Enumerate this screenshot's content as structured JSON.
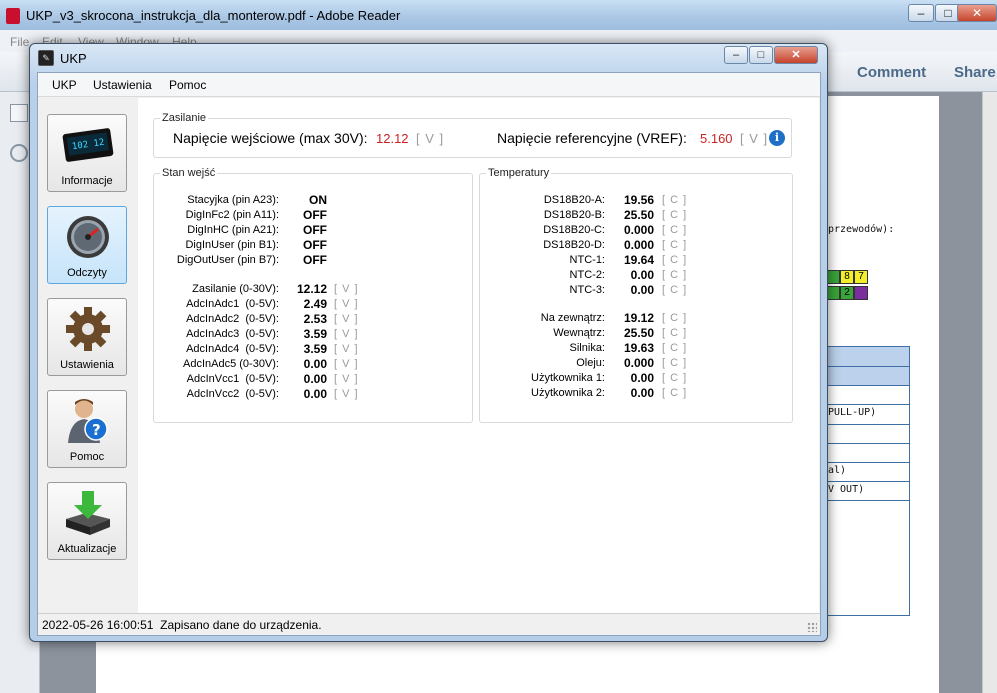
{
  "background": {
    "title": "UKP_v3_skrocona_instrukcja_dla_monterow.pdf - Adobe Reader",
    "menu": [
      "File",
      "Edit",
      "View",
      "Window",
      "Help"
    ],
    "toolbar": {
      "comment": "Comment",
      "share": "Share"
    },
    "doc_fragments": {
      "wires": "przewodów):",
      "pullup": "PULL-UP)",
      "al": "al)",
      "vout": "V OUT)",
      "pin8": "8",
      "pin7": "7",
      "pin2": "2"
    }
  },
  "window": {
    "title": "UKP",
    "menu": {
      "ukp": "UKP",
      "settings": "Ustawienia",
      "help": "Pomoc"
    }
  },
  "nav": [
    {
      "label": "Informacje",
      "icon": "display-icon"
    },
    {
      "label": "Odczyty",
      "icon": "gauge-icon",
      "active": true
    },
    {
      "label": "Ustawienia",
      "icon": "gear-icon"
    },
    {
      "label": "Pomoc",
      "icon": "help-person-icon"
    },
    {
      "label": "Aktualizacje",
      "icon": "download-icon"
    }
  ],
  "supply": {
    "title": "Zasilanie",
    "input_label": "Napięcie wejściowe (max 30V):",
    "input_value": "12.12",
    "input_unit": "[ V ]",
    "ref_label": "Napięcie referencyjne (VREF):",
    "ref_value": "5.160",
    "ref_unit": "[ V ]",
    "value_color": "#cc2222"
  },
  "inputs": {
    "title": "Stan wejść",
    "digital": [
      {
        "label": "Stacyjka (pin A23):",
        "value": "ON"
      },
      {
        "label": "DigInFc2 (pin A11):",
        "value": "OFF"
      },
      {
        "label": "DigInHC (pin A21):",
        "value": "OFF"
      },
      {
        "label": "DigInUser (pin B1):",
        "value": "OFF"
      },
      {
        "label": "DigOutUser (pin B7):",
        "value": "OFF"
      }
    ],
    "analog": [
      {
        "label": "Zasilanie (0-30V):",
        "value": "12.12",
        "unit": "[ V ]"
      },
      {
        "label": "AdcInAdc1  (0-5V):",
        "value": "2.49",
        "unit": "[ V ]"
      },
      {
        "label": "AdcInAdc2  (0-5V):",
        "value": "2.53",
        "unit": "[ V ]"
      },
      {
        "label": "AdcInAdc3  (0-5V):",
        "value": "3.59",
        "unit": "[ V ]"
      },
      {
        "label": "AdcInAdc4  (0-5V):",
        "value": "3.59",
        "unit": "[ V ]"
      },
      {
        "label": "AdcInAdc5 (0-30V):",
        "value": "0.00",
        "unit": "[ V ]"
      },
      {
        "label": "AdcInVcc1  (0-5V):",
        "value": "0.00",
        "unit": "[ V ]"
      },
      {
        "label": "AdcInVcc2  (0-5V):",
        "value": "0.00",
        "unit": "[ V ]"
      }
    ]
  },
  "temperatures": {
    "title": "Temperatury",
    "sensors": [
      {
        "label": "DS18B20-A:",
        "value": "19.56",
        "unit": "[ C ]"
      },
      {
        "label": "DS18B20-B:",
        "value": "25.50",
        "unit": "[ C ]"
      },
      {
        "label": "DS18B20-C:",
        "value": "0.000",
        "unit": "[ C ]"
      },
      {
        "label": "DS18B20-D:",
        "value": "0.000",
        "unit": "[ C ]"
      },
      {
        "label": "NTC-1:",
        "value": "19.64",
        "unit": "[ C ]"
      },
      {
        "label": "NTC-2:",
        "value": "0.00",
        "unit": "[ C ]"
      },
      {
        "label": "NTC-3:",
        "value": "0.00",
        "unit": "[ C ]"
      }
    ],
    "named": [
      {
        "label": "Na zewnątrz:",
        "value": "19.12",
        "unit": "[ C ]"
      },
      {
        "label": "Wewnątrz:",
        "value": "25.50",
        "unit": "[ C ]"
      },
      {
        "label": "Silnika:",
        "value": "19.63",
        "unit": "[ C ]"
      },
      {
        "label": "Oleju:",
        "value": "0.000",
        "unit": "[ C ]"
      },
      {
        "label": "Użytkownika 1:",
        "value": "0.00",
        "unit": "[ C ]"
      },
      {
        "label": "Użytkownika 2:",
        "value": "0.00",
        "unit": "[ C ]"
      }
    ]
  },
  "status": {
    "timestamp": "2022-05-26 16:00:51",
    "message": "Zapisano dane do urządzenia."
  }
}
